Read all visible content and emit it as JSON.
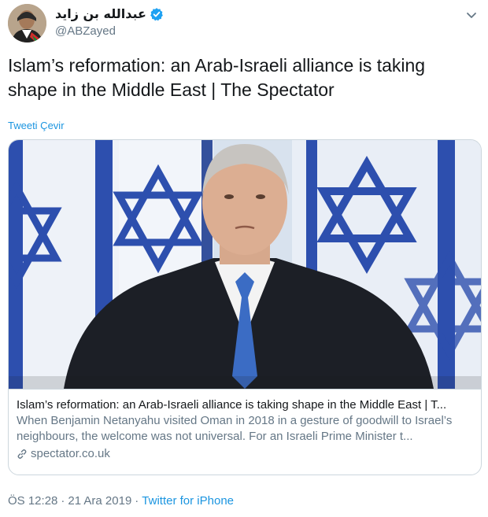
{
  "author": {
    "display_name": "عبدالله بن زايد",
    "handle": "@ABZayed",
    "verified": true,
    "avatar_icon": "profile-photo"
  },
  "tweet": {
    "text": "Islam’s reformation: an Arab-Israeli alliance is taking shape in the Middle East | The Spectator",
    "translate_label": "Tweeti Çevir"
  },
  "card": {
    "image_icon": "news-photo",
    "title": "Islam’s reformation: an Arab-Israeli alliance is taking shape in the Middle East | T...",
    "description": "When Benjamin Netanyahu visited Oman in 2018 in a gesture of goodwill to Israel’s neighbours, the welcome was not universal. For an Israeli Prime Minister t...",
    "domain": "spectator.co.uk",
    "domain_icon": "link-icon"
  },
  "meta": {
    "time": "ÖS 12:28",
    "separator1": "·",
    "date": "21 Ara 2019",
    "separator2": "·",
    "source": "Twitter for iPhone"
  },
  "colors": {
    "link": "#1b95e0",
    "secondary_text": "#657786",
    "border": "#ccd6dd",
    "verified": "#1da1f2",
    "flag_blue": "#1f3e9c"
  }
}
